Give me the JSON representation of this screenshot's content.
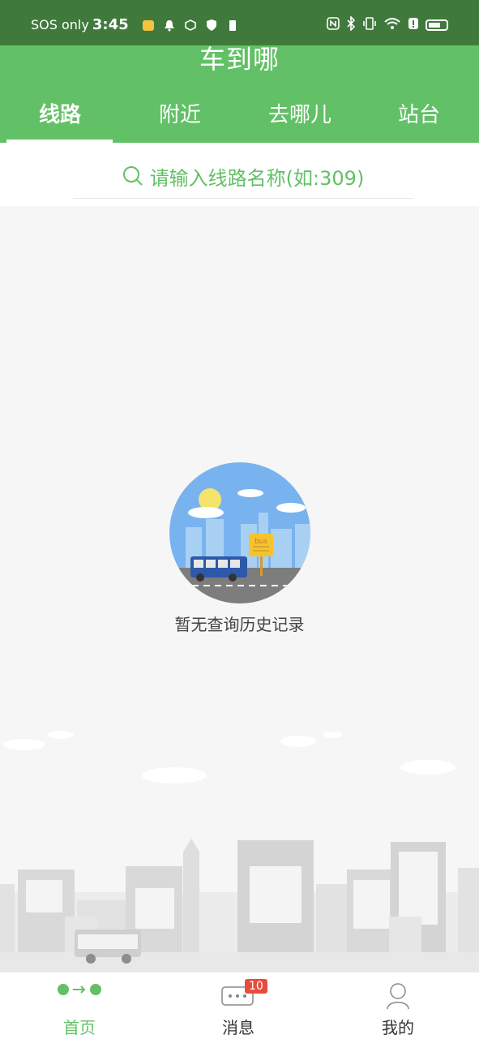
{
  "status_bar": {
    "carrier": "SOS only",
    "time": "3:45"
  },
  "header": {
    "title": "车到哪",
    "tabs": [
      {
        "label": "线路",
        "active": true
      },
      {
        "label": "附近",
        "active": false
      },
      {
        "label": "去哪儿",
        "active": false
      },
      {
        "label": "站台",
        "active": false
      }
    ]
  },
  "search": {
    "placeholder": "请输入线路名称(如:309)"
  },
  "empty_state": {
    "bus_sign": "bus",
    "message": "暂无查询历史记录"
  },
  "bottom_nav": {
    "items": [
      {
        "label": "首页",
        "icon": "home-route-icon",
        "active": true
      },
      {
        "label": "消息",
        "icon": "message-icon",
        "active": false,
        "badge": "10"
      },
      {
        "label": "我的",
        "icon": "profile-icon",
        "active": false
      }
    ]
  },
  "colors": {
    "accent": "#62c066",
    "status_bar": "#3f7a3c",
    "badge": "#e84c3d"
  }
}
